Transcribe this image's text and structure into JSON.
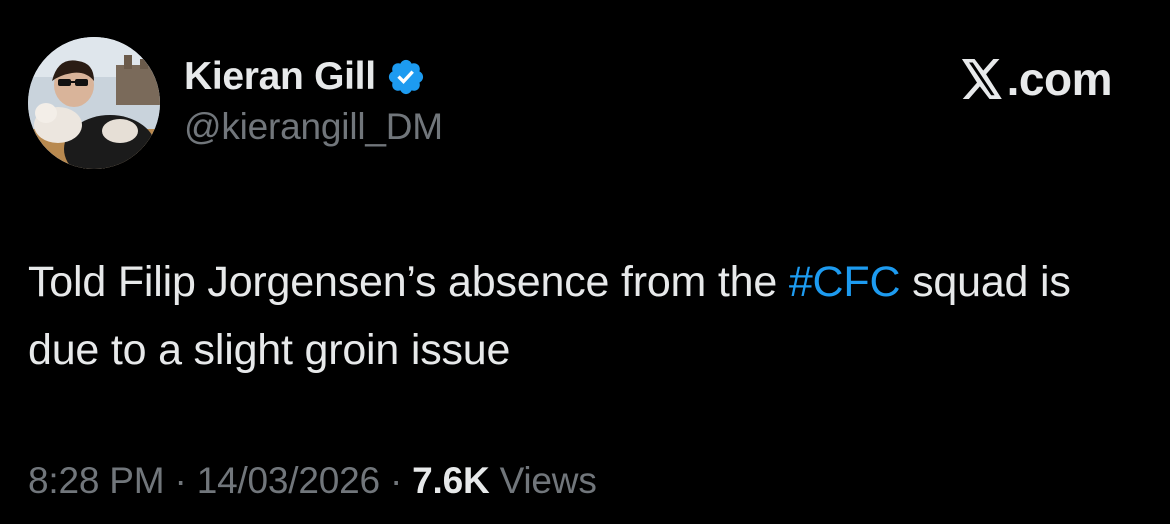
{
  "author": {
    "display_name": "Kieran Gill",
    "handle": "@kierangill_DM",
    "verified": true,
    "avatar_icon": "profile-photo"
  },
  "brand": {
    "domain": ".com",
    "logo_icon": "x-logo-icon"
  },
  "tweet": {
    "text_before": "Told Filip Jorgensen’s absence from the ",
    "hashtag": "#CFC",
    "text_after": " squad is due to a slight groin issue"
  },
  "meta": {
    "time": "8:28 PM",
    "separator": " · ",
    "date": "14/03/2026",
    "views_count": "7.6K",
    "views_label": " Views"
  },
  "colors": {
    "background": "#000000",
    "text_primary": "#e7e9ea",
    "text_secondary": "#71767b",
    "accent": "#1d9bf0"
  }
}
